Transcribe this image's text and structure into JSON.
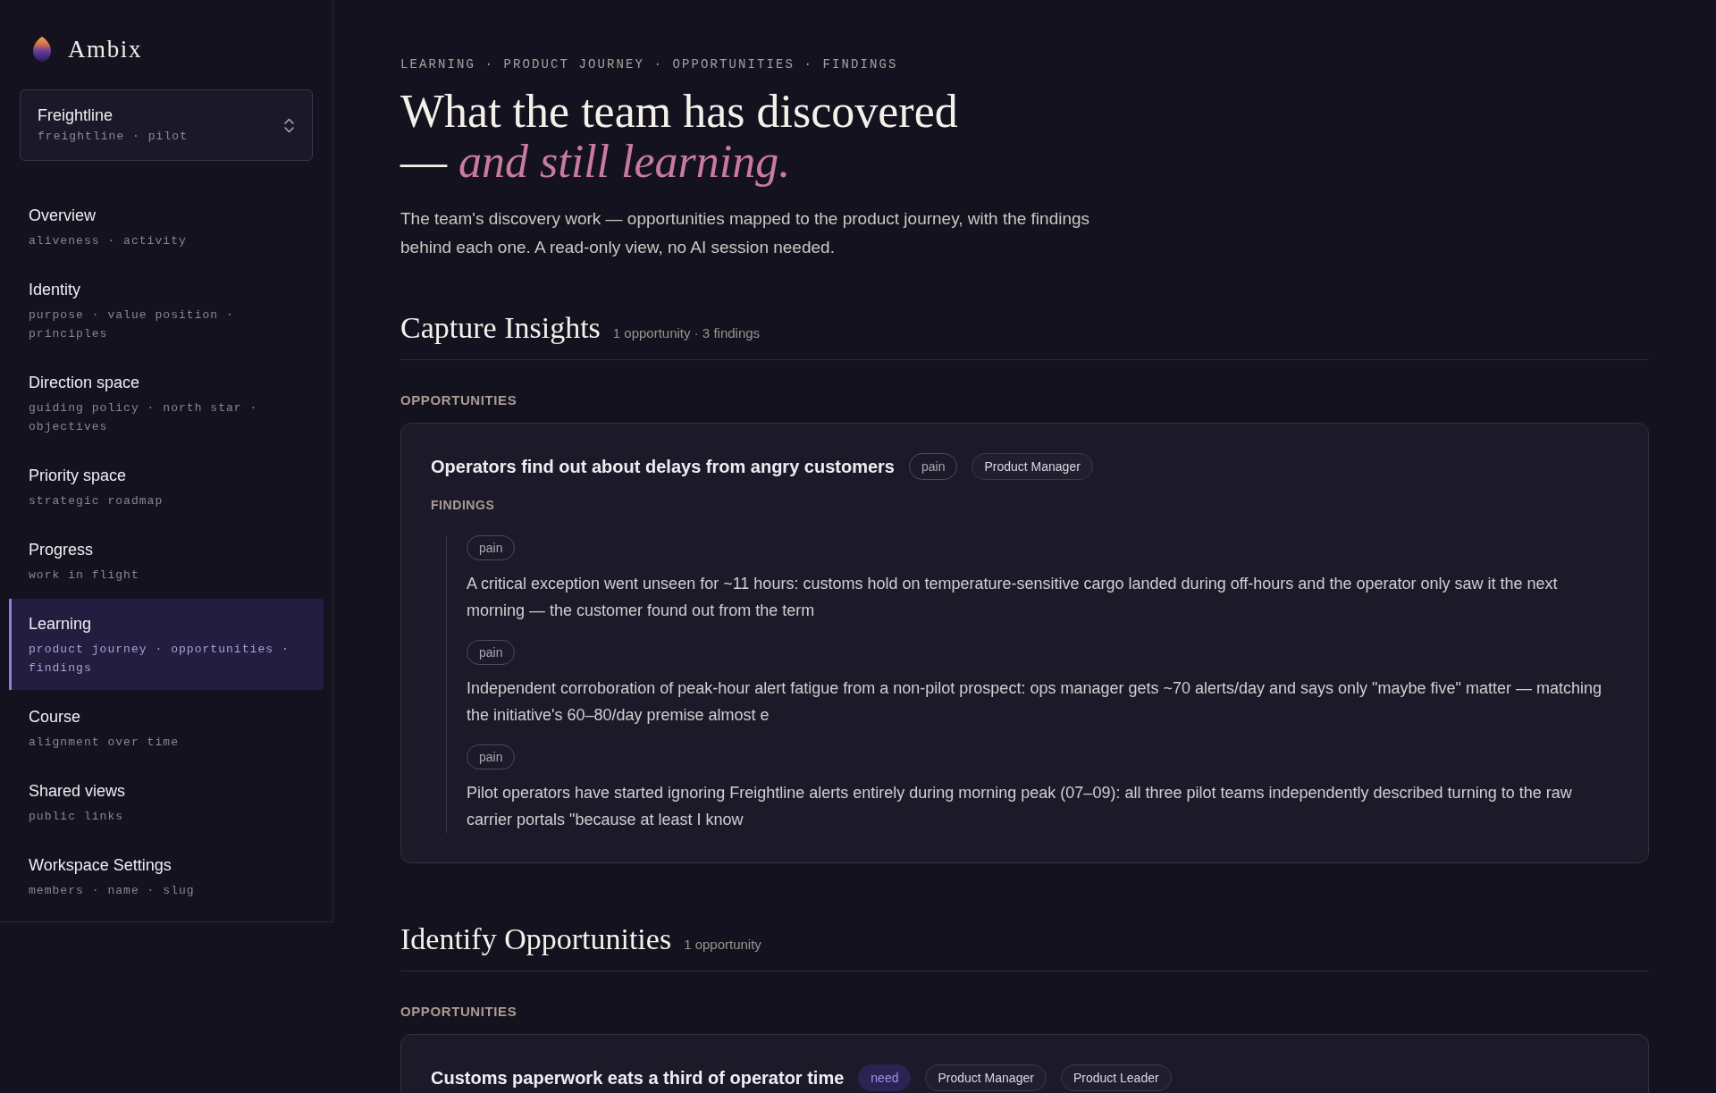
{
  "brand": {
    "name": "Ambix"
  },
  "workspace": {
    "name": "Freightline",
    "meta": "freightline · pilot"
  },
  "nav": [
    {
      "label": "Overview",
      "sublabel": "aliveness · activity",
      "selected": false
    },
    {
      "label": "Identity",
      "sublabel": "purpose · value position · principles",
      "selected": false
    },
    {
      "label": "Direction space",
      "sublabel": "guiding policy · north star · objectives",
      "selected": false
    },
    {
      "label": "Priority space",
      "sublabel": "strategic roadmap",
      "selected": false
    },
    {
      "label": "Progress",
      "sublabel": "work in flight",
      "selected": false
    },
    {
      "label": "Learning",
      "sublabel": "product journey · opportunities · findings",
      "selected": true
    },
    {
      "label": "Course",
      "sublabel": "alignment over time",
      "selected": false
    },
    {
      "label": "Shared views",
      "sublabel": "public links",
      "selected": false
    },
    {
      "label": "Workspace Settings",
      "sublabel": "members · name · slug",
      "selected": false
    }
  ],
  "breadcrumb": "LEARNING · PRODUCT JOURNEY · OPPORTUNITIES · FINDINGS",
  "heading": {
    "line_1": "What the team has discovered",
    "line_2_lead": "—",
    "line_2_emphasis": "and still learning."
  },
  "intro": "The team's discovery work — opportunities mapped to the product journey, with the findings behind each one. A read-only view, no AI session needed.",
  "sections": [
    {
      "title": "Capture Insights",
      "count": "1 opportunity · 3 findings",
      "label": "OPPORTUNITIES",
      "opportunities": [
        {
          "title": "Operators find out about delays from angry customers",
          "tags": [
            {
              "text": "pain",
              "kind": "pain"
            },
            {
              "text": "Product Manager",
              "kind": "role"
            }
          ],
          "findings_label": "FINDINGS",
          "findings": [
            {
              "tag": {
                "text": "pain",
                "kind": "pain"
              },
              "text": "A critical exception went unseen for ~11 hours: customs hold on temperature-sensitive cargo landed during off-hours and the operator only saw it the next morning — the customer found out from the term"
            },
            {
              "tag": {
                "text": "pain",
                "kind": "pain"
              },
              "text": "Independent corroboration of peak-hour alert fatigue from a non-pilot prospect: ops manager gets ~70 alerts/day and says only \"maybe five\" matter — matching the initiative's 60–80/day premise almost e"
            },
            {
              "tag": {
                "text": "pain",
                "kind": "pain"
              },
              "text": "Pilot operators have started ignoring Freightline alerts entirely during morning peak (07–09): all three pilot teams independently described turning to the raw carrier portals \"because at least I know"
            }
          ]
        }
      ]
    },
    {
      "title": "Identify Opportunities",
      "count": "1 opportunity",
      "label": "OPPORTUNITIES",
      "opportunities": [
        {
          "title": "Customs paperwork eats a third of operator time",
          "tags": [
            {
              "text": "need",
              "kind": "need"
            },
            {
              "text": "Product Manager",
              "kind": "role"
            },
            {
              "text": "Product Leader",
              "kind": "role"
            }
          ]
        }
      ]
    }
  ]
}
